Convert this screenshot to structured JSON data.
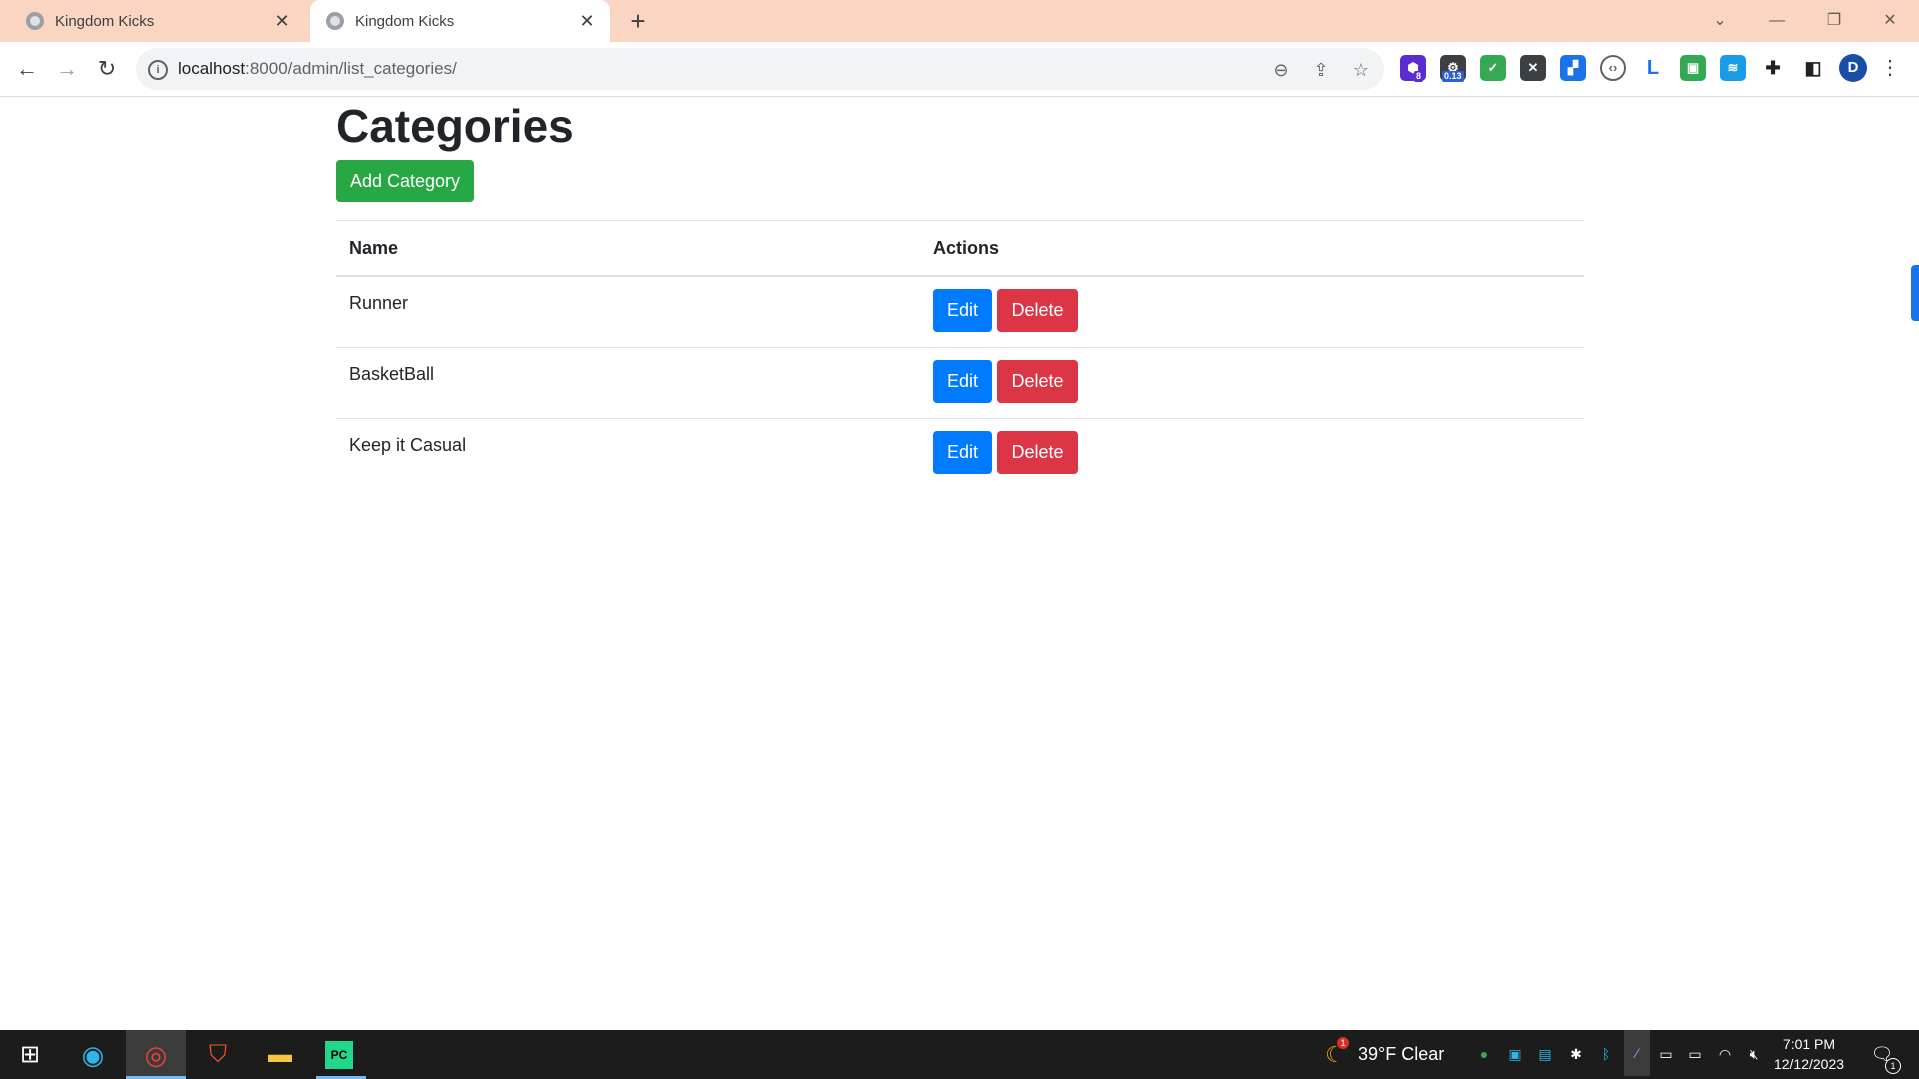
{
  "browser": {
    "tabs": [
      {
        "title": "Kingdom Kicks",
        "active": false
      },
      {
        "title": "Kingdom Kicks",
        "active": true
      }
    ],
    "url_host": "localhost",
    "url_rest": ":8000/admin/list_categories/",
    "extensions": [
      {
        "name": "extension-hex-icon",
        "badge": "8",
        "color": "#5b2ccf"
      },
      {
        "name": "extension-robot-icon",
        "badge": "0.13",
        "color": "#2d5fd4"
      },
      {
        "name": "extension-green-shield-icon",
        "color": "#34a853"
      },
      {
        "name": "extension-brave-shield-icon",
        "color": "#3c4043"
      },
      {
        "name": "extension-blue-square-icon",
        "color": "#1a73e8"
      },
      {
        "name": "extension-code-icon",
        "color": "#5f6368"
      },
      {
        "name": "extension-l-icon",
        "color": "#1a73e8"
      },
      {
        "name": "extension-green-lock-icon",
        "color": "#34a853"
      },
      {
        "name": "extension-blue-chat-icon",
        "color": "#1a9be8"
      }
    ],
    "profile_initial": "D"
  },
  "page": {
    "heading": "Categories",
    "add_button": "Add Category",
    "table": {
      "headers": [
        "Name",
        "Actions"
      ],
      "rows": [
        {
          "name": "Runner"
        },
        {
          "name": "BasketBall"
        },
        {
          "name": "Keep it Casual"
        }
      ],
      "edit_label": "Edit",
      "delete_label": "Delete"
    },
    "colors": {
      "success": "#28a745",
      "primary": "#007bff",
      "danger": "#dc3545"
    }
  },
  "taskbar": {
    "weather_badge": "1",
    "weather": "39°F  Clear",
    "time": "7:01 PM",
    "date": "12/12/2023",
    "notification_count": "1"
  }
}
